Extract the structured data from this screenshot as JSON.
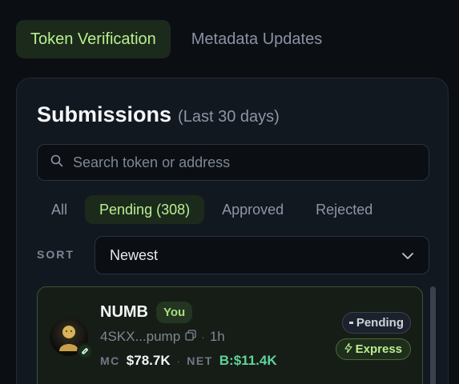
{
  "tabs": [
    {
      "label": "Token Verification",
      "active": true
    },
    {
      "label": "Metadata Updates",
      "active": false
    }
  ],
  "panel": {
    "title": "Submissions",
    "subtitle": "(Last 30 days)"
  },
  "search": {
    "placeholder": "Search token or address",
    "value": "",
    "icon": "search-icon"
  },
  "filters": [
    {
      "label": "All",
      "active": false
    },
    {
      "label": "Pending (308)",
      "active": true
    },
    {
      "label": "Approved",
      "active": false
    },
    {
      "label": "Rejected",
      "active": false
    }
  ],
  "sort": {
    "label": "SORT",
    "value": "Newest",
    "icon": "chevron-down-icon"
  },
  "submissions": [
    {
      "name": "NUMB",
      "you_badge": "You",
      "address": "4SKX...pump",
      "age": "1h",
      "mc_label": "MC",
      "mc_value": "$78.7K",
      "net_label": "NET",
      "net_value": "B:$11.4K",
      "status": "Pending",
      "tier": "Express",
      "colors": {
        "status_dot": "#cdd2da",
        "express": "#b9ef8f",
        "net": "#5fd39c"
      }
    }
  ],
  "colors": {
    "accent": "#b9ef8f",
    "background": "#0b0e13",
    "panel": "#121820"
  }
}
